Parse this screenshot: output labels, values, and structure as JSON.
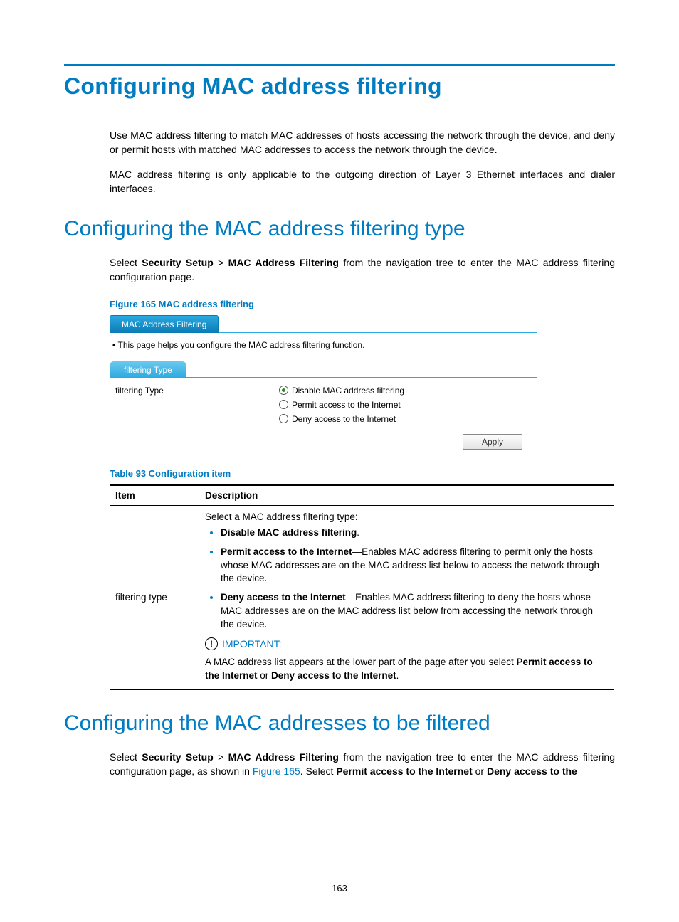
{
  "title": "Configuring MAC address filtering",
  "intro": {
    "p1": "Use MAC address filtering to match MAC addresses of hosts accessing the network through the device, and deny or permit hosts with matched MAC addresses to access the network through the device.",
    "p2": "MAC address filtering is only applicable to the outgoing direction of Layer 3 Ethernet interfaces and dialer interfaces."
  },
  "section1": {
    "heading": "Configuring the MAC address filtering type",
    "nav_prefix": "Select ",
    "nav_b1": "Security Setup",
    "nav_gt": " > ",
    "nav_b2": "MAC Address Filtering",
    "nav_suffix": " from the navigation tree to enter the MAC address filtering configuration page.",
    "figure_caption": "Figure 165 MAC address filtering",
    "screenshot": {
      "tab": "MAC Address Filtering",
      "help": "This page helps you configure the MAC address filtering function.",
      "subtab": "filtering Type",
      "label": "filtering Type",
      "options": {
        "o1": "Disable MAC address filtering",
        "o2": "Permit access to the Internet",
        "o3": "Deny access to the Internet"
      },
      "apply": "Apply"
    },
    "table_caption": "Table 93 Configuration item",
    "table": {
      "h_item": "Item",
      "h_desc": "Description",
      "row_item": "filtering type",
      "desc_lead": "Select a MAC address filtering type:",
      "li1_b": "Disable MAC address filtering",
      "li1_suffix": ".",
      "li2_b": "Permit access to the Internet",
      "li2_suffix": "—Enables MAC address filtering to permit only the hosts whose MAC addresses are on the MAC address list below to access the network through the device.",
      "li3_b": "Deny access to the Internet",
      "li3_suffix": "—Enables MAC address filtering to deny the hosts whose MAC addresses are on the MAC address list below from accessing the network through the device.",
      "important_label": "IMPORTANT:",
      "note_prefix": "A MAC address list appears at the lower part of the page after you select ",
      "note_b1": "Permit access to the Internet",
      "note_mid": " or ",
      "note_b2": "Deny access to the Internet",
      "note_suffix": "."
    }
  },
  "section2": {
    "heading": "Configuring the MAC addresses to be filtered",
    "p_prefix": "Select ",
    "p_b1": "Security Setup",
    "p_gt": " > ",
    "p_b2": "MAC Address Filtering",
    "p_mid1": " from the navigation tree to enter the MAC address filtering configuration page, as shown in ",
    "p_link": "Figure 165",
    "p_mid2": ". Select ",
    "p_b3": "Permit access to the Internet",
    "p_mid3": " or ",
    "p_b4": "Deny access to the"
  },
  "page_number": "163"
}
